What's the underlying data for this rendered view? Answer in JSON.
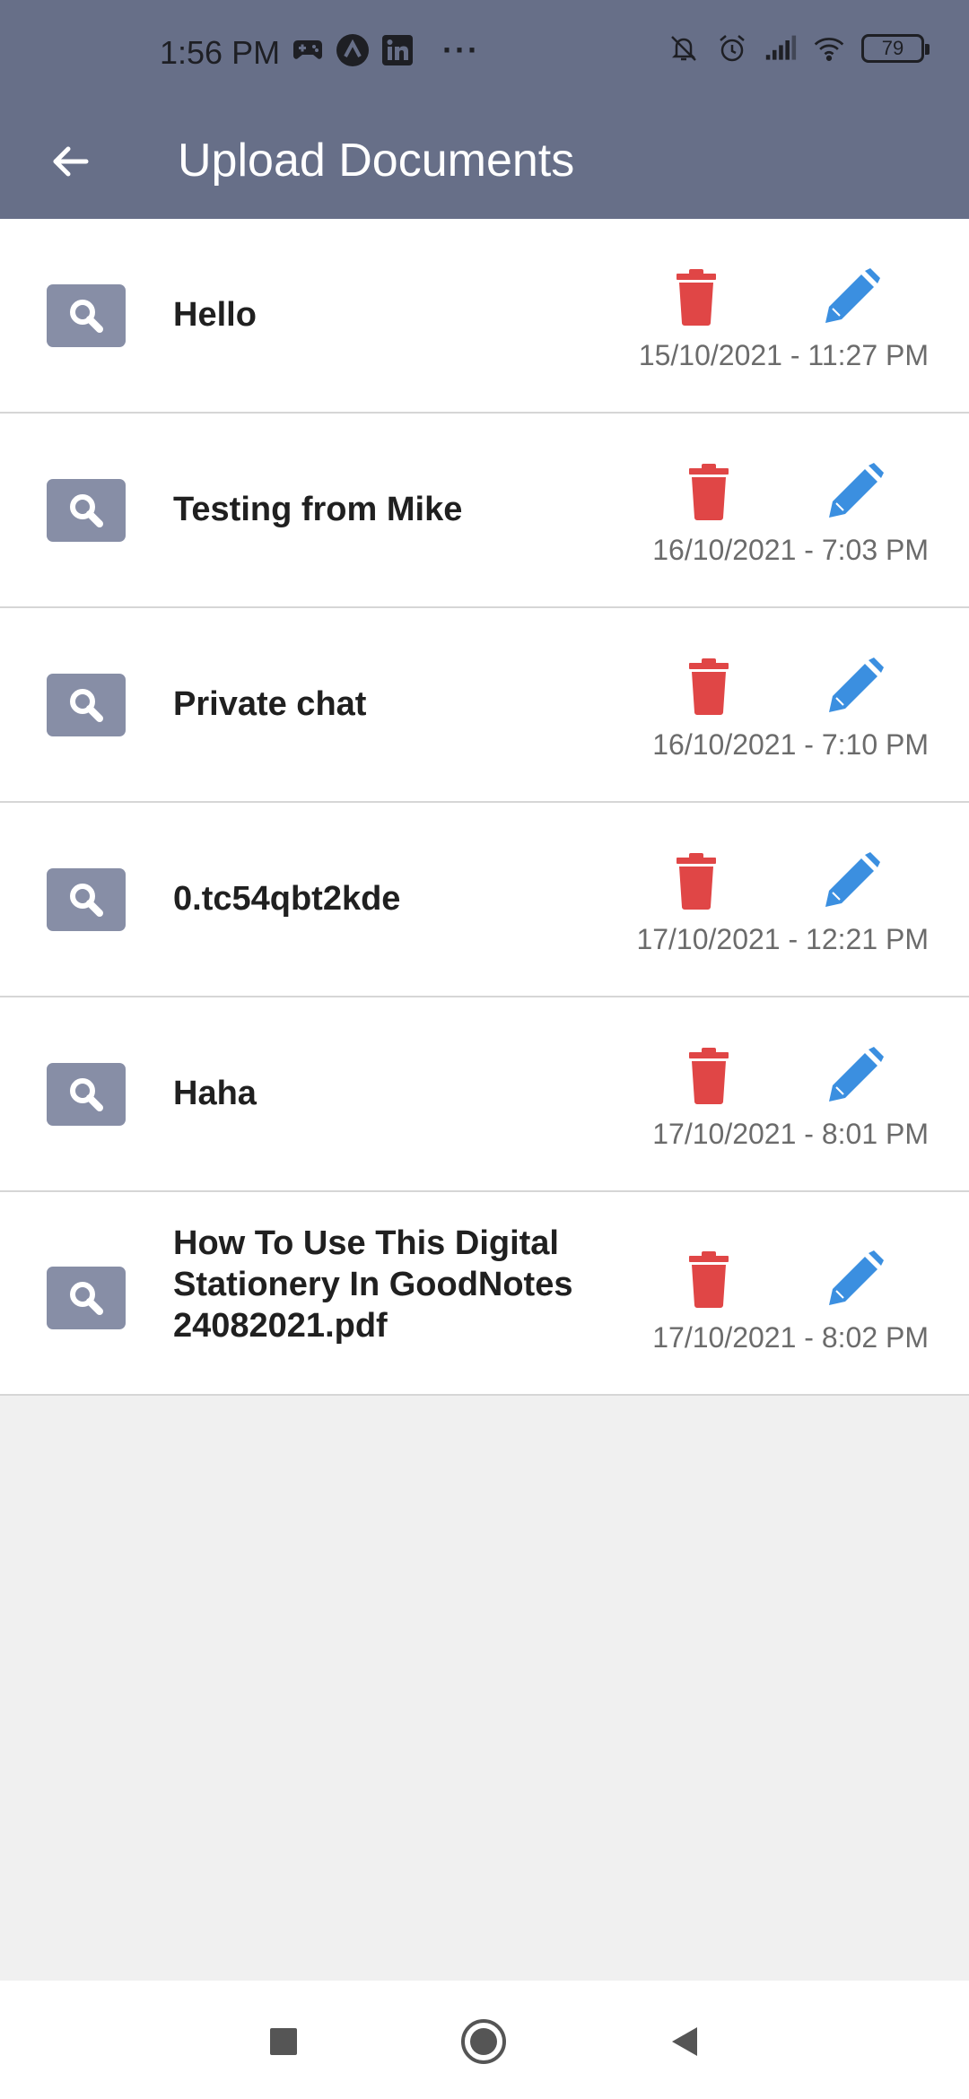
{
  "status_bar": {
    "time": "1:56 PM",
    "battery": "79",
    "left_icons": [
      "gamepad-icon",
      "app-icon",
      "linkedin-icon"
    ],
    "more": "···",
    "right_icons": [
      "bell-off-icon",
      "alarm-icon",
      "signal-icon",
      "wifi-icon",
      "battery-icon"
    ]
  },
  "app_bar": {
    "title": "Upload Documents",
    "back_icon": "arrow-back-icon"
  },
  "documents": [
    {
      "name": "Hello",
      "date": "15/10/2021 - 11:27 PM"
    },
    {
      "name": "Testing from Mike",
      "date": "16/10/2021 - 7:03 PM"
    },
    {
      "name": "Private chat",
      "date": "16/10/2021 - 7:10 PM"
    },
    {
      "name": "0.tc54qbt2kde",
      "date": "17/10/2021 - 12:21 PM"
    },
    {
      "name": "Haha",
      "date": "17/10/2021 - 8:01 PM"
    },
    {
      "name": "How To Use This Digital Stationery In GoodNotes 24082021.pdf",
      "date": "17/10/2021 - 8:02 PM"
    }
  ],
  "row_icons": {
    "view": "search-icon",
    "delete": "trash-icon",
    "edit": "pencil-icon"
  },
  "colors": {
    "header": "#676f88",
    "view_button": "#878ea6",
    "delete": "#e04646",
    "edit": "#3b8fe0",
    "background": "#f0f0f0"
  },
  "nav_bar": {
    "buttons": [
      "recents-icon",
      "home-icon",
      "back-icon"
    ]
  }
}
